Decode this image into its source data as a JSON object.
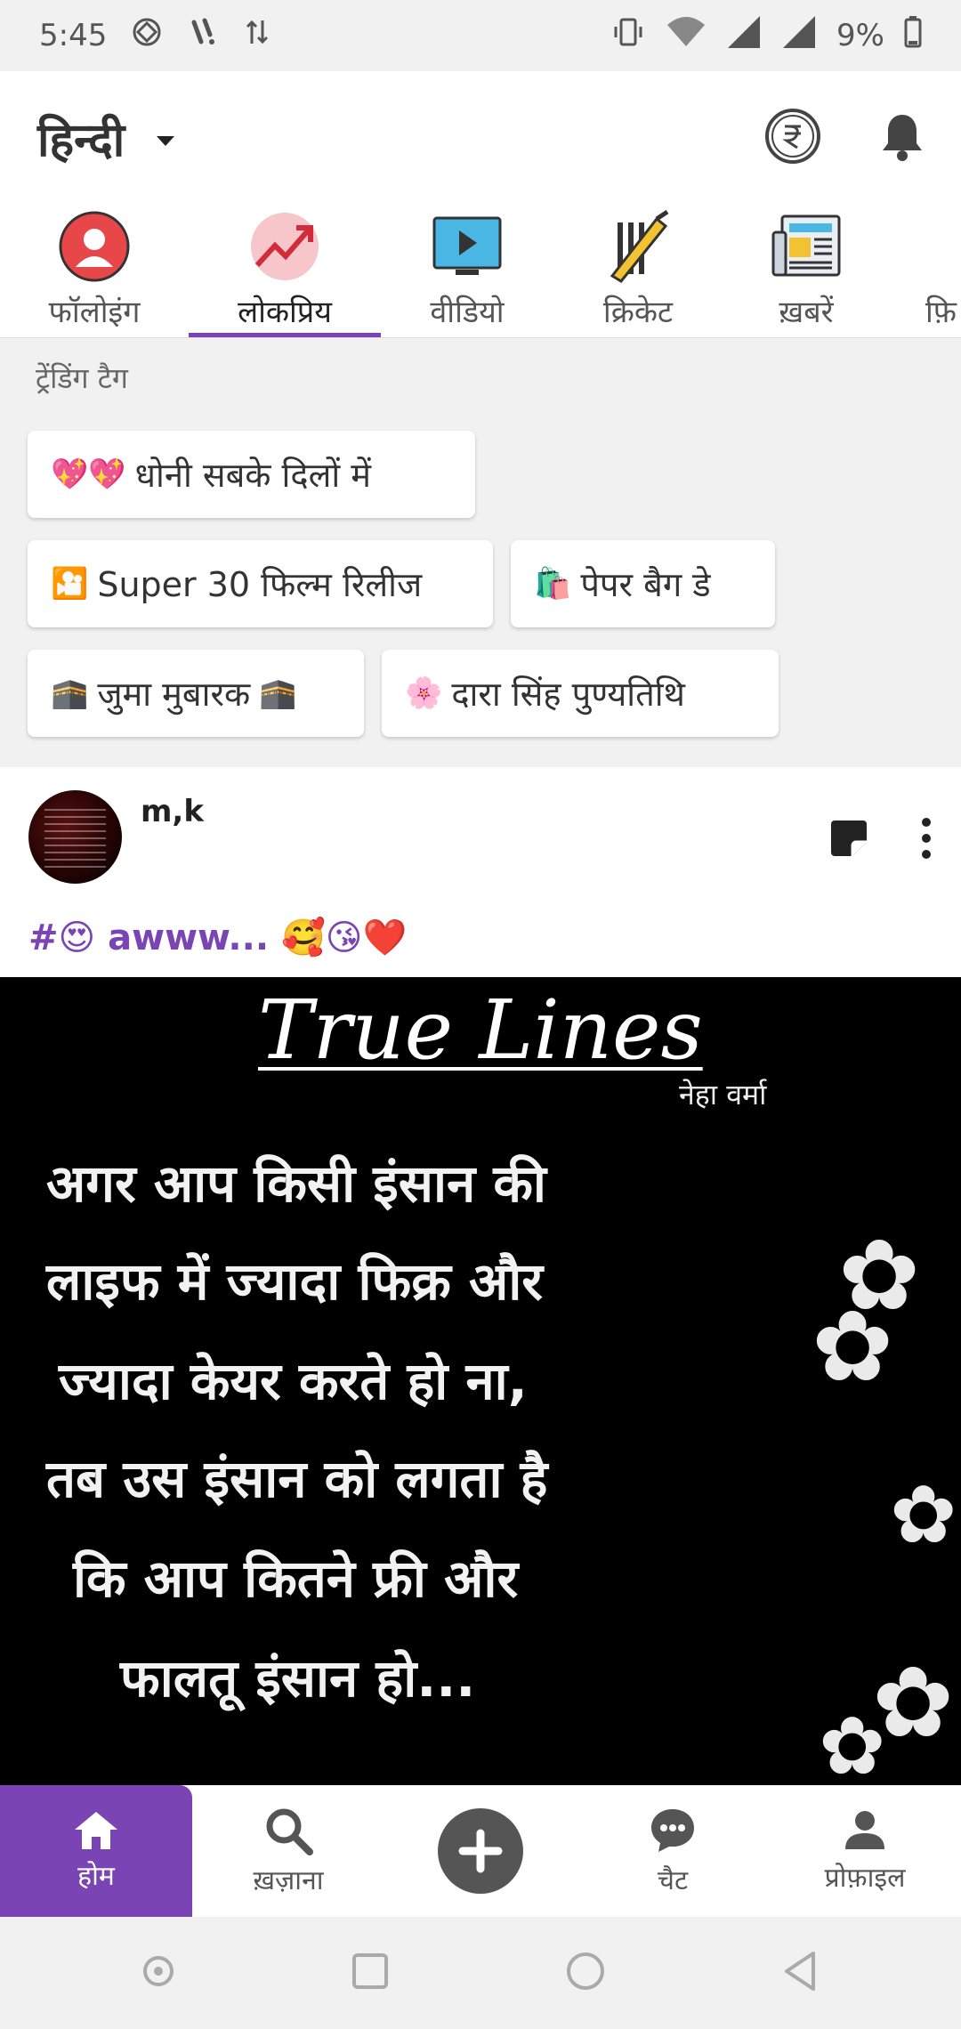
{
  "status_bar": {
    "time": "5:45",
    "battery": "9%"
  },
  "header": {
    "language": "हिन्दी"
  },
  "tabs": [
    {
      "label": "फॉलोइंग",
      "icon": "following-icon"
    },
    {
      "label": "लोकप्रिय",
      "icon": "trending-icon",
      "active": true
    },
    {
      "label": "वीडियो",
      "icon": "video-icon"
    },
    {
      "label": "क्रिकेट",
      "icon": "cricket-icon"
    },
    {
      "label": "ख़बरें",
      "icon": "news-icon"
    },
    {
      "label": "फ़ि",
      "icon": "film-icon"
    }
  ],
  "trending": {
    "title": "ट्रेंडिंग टैग",
    "tags": [
      {
        "emoji": "💖💖",
        "label": "धोनी सबके दिलों में"
      },
      {
        "emoji": "🎦",
        "label": "Super 30 फिल्म रिलीज"
      },
      {
        "emoji": "🛍️",
        "label": "पेपर बैग डे"
      },
      {
        "emoji": "🕋",
        "label": "जुमा मुबारक",
        "suffix": "🕋"
      },
      {
        "emoji": "🌸",
        "label": "दारा सिंह पुण्यतिथि"
      }
    ]
  },
  "post": {
    "username": "m,k",
    "caption": "#😍 awww... 🥰😘❤️",
    "image": {
      "title": "True Lines",
      "author": "नेहा वर्मा",
      "lines": [
        "अगर आप किसी इंसान की",
        "लाइफ में ज्यादा फिक्र और",
        "ज्यादा केयर करते हो ना,",
        "तब उस इंसान को लगता है",
        "कि आप कितने फ्री और",
        "फालतू इंसान हो..."
      ]
    }
  },
  "bottom_nav": [
    {
      "label": "होम",
      "active": true
    },
    {
      "label": "ख़ज़ाना"
    },
    {
      "label": ""
    },
    {
      "label": "चैट"
    },
    {
      "label": "प्रोफ़ाइल"
    }
  ],
  "colors": {
    "accent": "#7b44b5",
    "background": "#f1f1f1"
  }
}
